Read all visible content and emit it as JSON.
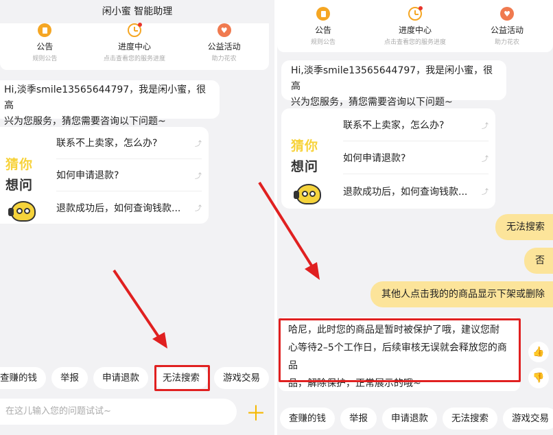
{
  "left": {
    "title": "闲小蜜 智能助理",
    "quick_links": [
      {
        "label": "公告",
        "sub": "规则公告",
        "icon": "notice-icon"
      },
      {
        "label": "进度中心",
        "sub": "点击查看您的服务进度",
        "icon": "progress-clock-icon"
      },
      {
        "label": "公益活动",
        "sub": "助力花农",
        "icon": "charity-heart-icon"
      }
    ],
    "greeting_line1": "Hi,淡季smile13565644797，我是闲小蜜，很高",
    "greeting_line2": "兴为您服务，猜您需要咨询以下问题~",
    "guess_title_top": "猜你",
    "guess_title_bottom": "想问",
    "questions": [
      "联系不上卖家，怎么办?",
      "如何申请退款?",
      "退款成功后，如何查询钱款..."
    ],
    "chips": [
      "查赚的钱",
      "举报",
      "申请退款",
      "无法搜索",
      "游戏交易"
    ],
    "input_placeholder": "在这儿输入您的问题试试~"
  },
  "right": {
    "quick_links": [
      {
        "label": "公告",
        "sub": "规则公告",
        "icon": "notice-icon"
      },
      {
        "label": "进度中心",
        "sub": "点击查看您的服务进度",
        "icon": "progress-clock-icon"
      },
      {
        "label": "公益活动",
        "sub": "助力花农",
        "icon": "charity-heart-icon"
      }
    ],
    "greeting_line1": "Hi,淡季smile13565644797，我是闲小蜜，很高",
    "greeting_line2": "兴为您服务，猜您需要咨询以下问题~",
    "guess_title_top": "猜你",
    "guess_title_bottom": "想问",
    "questions": [
      "联系不上卖家，怎么办?",
      "如何申请退款?",
      "退款成功后，如何查询钱款..."
    ],
    "user_messages": [
      "无法搜索",
      "否",
      "其他人点击我的的商品显示下架或删除"
    ],
    "answer_line1": "哈尼，此时您的商品是暂时被保护了哦，建议您耐",
    "answer_line2": "心等待2–5个工作日，后续审核无误就会释放您的商品",
    "answer_line3": "品，解除保护，正常展示的哦~",
    "chips": [
      "查赚的钱",
      "举报",
      "申请退款",
      "无法搜索",
      "游戏交易"
    ]
  },
  "colors": {
    "highlight_red": "#e02020",
    "user_bubble": "#fce49a",
    "accent_yellow": "#f5b800"
  }
}
